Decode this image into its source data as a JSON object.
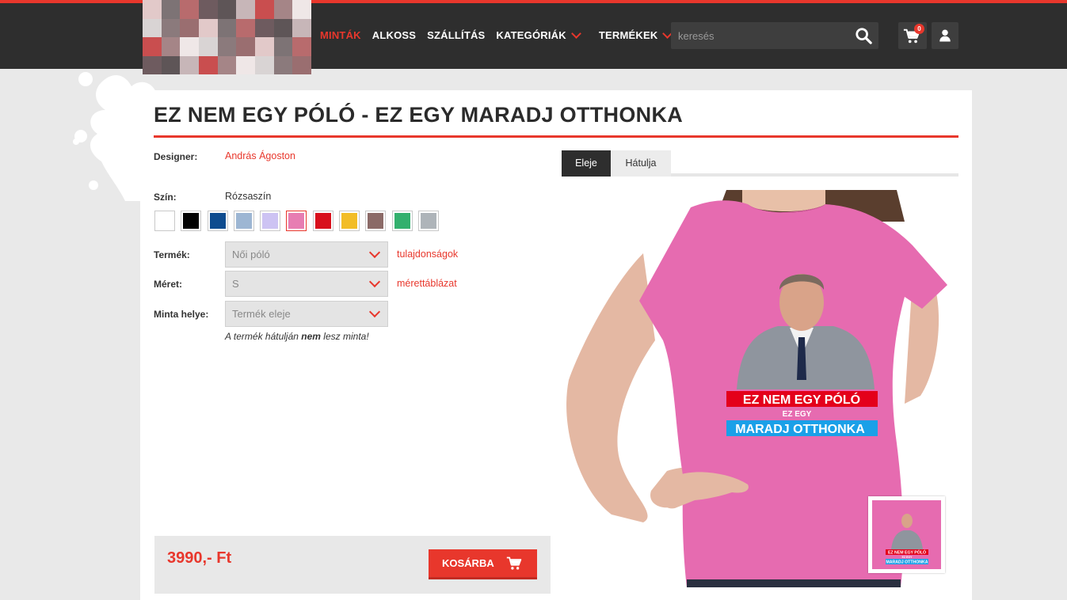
{
  "header": {
    "nav": [
      {
        "label": "MINTÁK",
        "active": true,
        "dropdown": false
      },
      {
        "label": "ALKOSS",
        "active": false,
        "dropdown": false
      },
      {
        "label": "SZÁLLÍTÁS",
        "active": false,
        "dropdown": false
      },
      {
        "label": "KATEGÓRIÁK",
        "active": false,
        "dropdown": true
      },
      {
        "label": "TERMÉKEK",
        "active": false,
        "dropdown": true
      }
    ],
    "search_placeholder": "keresés",
    "cart_count": "0",
    "icons": {
      "search": "search-icon",
      "cart": "cart-icon",
      "user": "user-icon",
      "dropdown": "chevron-down-icon"
    }
  },
  "product": {
    "title": "EZ NEM EGY PÓLÓ - EZ EGY MARADJ OTTHONKA",
    "designer_label": "Designer:",
    "designer_name": "András Ágoston",
    "color_label": "Szín:",
    "color_name": "Rózsaszín",
    "colors": [
      "#ffffff",
      "#000000",
      "#0e4c8f",
      "#9db6d3",
      "#cdc3f3",
      "#e77db2",
      "#d8101c",
      "#f2bd27",
      "#8b6a67",
      "#33b06e",
      "#aeb4b9"
    ],
    "selected_color_index": 5,
    "product_label": "Termék:",
    "product_value": "Női póló",
    "properties_link": "tulajdonságok",
    "size_label": "Méret:",
    "size_value": "S",
    "size_chart_link": "mérettáblázat",
    "placement_label": "Minta helye:",
    "placement_value": "Termék eleje",
    "note_pre": "A termék hátulján ",
    "note_bold": "nem",
    "note_post": " lesz minta!",
    "price": "3990,- Ft",
    "add_to_cart": "KOSÁRBA",
    "tabs": [
      "Eleje",
      "Hátulja"
    ],
    "print_text": {
      "line1": "EZ NEM EGY PÓLÓ",
      "line2": "EZ EGY",
      "line3": "MARADJ OTTHONKA"
    },
    "accent_color": "#e8372c",
    "shirt_color": "#e66bb0"
  }
}
